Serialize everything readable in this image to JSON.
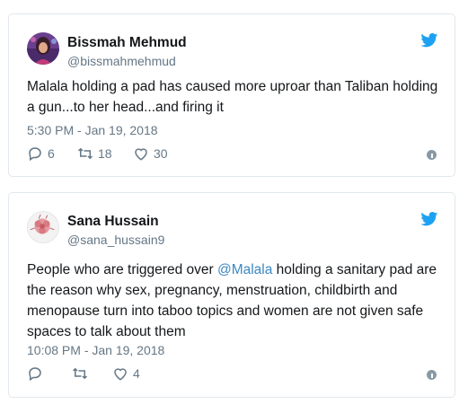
{
  "tweets": [
    {
      "name": "Bissmah Mehmud",
      "handle": "@bissmahmehmud",
      "text": "Malala holding a pad has caused more uproar than Taliban holding a gun...to her head...and firing it",
      "time": "5:30 PM - Jan 19, 2018",
      "replies": "6",
      "retweets": "18",
      "likes": "30",
      "avatar_icon": "avatar-photo-woman"
    },
    {
      "name": "Sana Hussain",
      "handle": "@sana_hussain9",
      "text_before": "People who are triggered over ",
      "mention": "@Malala",
      "text_after": " holding a sanitary pad are the reason why sex, pregnancy, menstruation, childbirth and menopause turn into taboo topics and women are not given safe spaces to talk about them",
      "time": "10:08 PM - Jan 19, 2018",
      "replies": "",
      "retweets": "",
      "likes": "4",
      "avatar_icon": "avatar-flower"
    }
  ],
  "colors": {
    "twitter_blue": "#1da1f2",
    "mention": "#3b88c3",
    "secondary_text": "#657786",
    "border": "#e1e8ed"
  }
}
